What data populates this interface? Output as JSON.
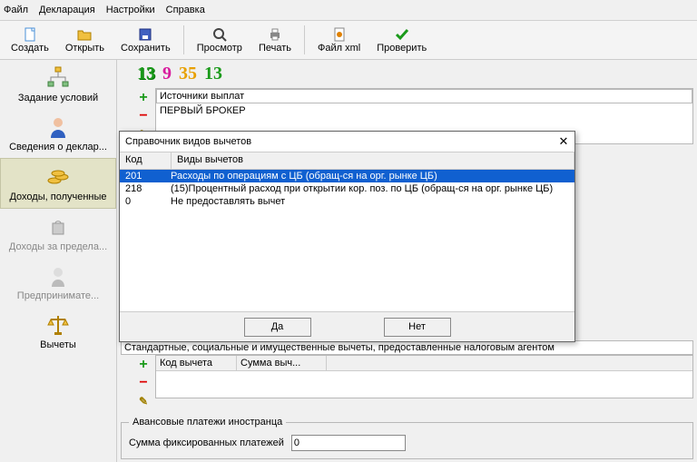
{
  "menu": {
    "file": "Файл",
    "decl": "Декларация",
    "settings": "Настройки",
    "help": "Справка"
  },
  "toolbar": {
    "create": "Создать",
    "open": "Открыть",
    "save": "Сохранить",
    "preview": "Просмотр",
    "print": "Печать",
    "xml": "Файл xml",
    "check": "Проверить"
  },
  "sidebar": {
    "cond": "Задание условий",
    "declarant": "Сведения о деклар...",
    "income_ru": "Доходы, полученные",
    "income_abroad": "Доходы за предела...",
    "entrepreneur": "Предпринимате...",
    "deductions": "Вычеты"
  },
  "tax_tabs": {
    "t13a": "13",
    "t9": "9",
    "t35": "35",
    "t13b": "13"
  },
  "sources": {
    "header": "Источники выплат",
    "row1": "ПЕРВЫЙ БРОКЕР"
  },
  "deduct_panel": {
    "header": "Стандартные, социальные и имущественные вычеты, предоставленные налоговым агентом",
    "col1": "Код вычета",
    "col2": "Сумма выч..."
  },
  "advance": {
    "legend": "Авансовые платежи иностранца",
    "label": "Сумма фиксированных платежей",
    "value": "0"
  },
  "dialog": {
    "title": "Справочник видов вычетов",
    "col_code": "Код",
    "col_type": "Виды вычетов",
    "rows": [
      {
        "code": "201",
        "desc": "Расходы по операциям с ЦБ (обращ-ся на орг. рынке ЦБ)"
      },
      {
        "code": "218",
        "desc": "(15)Процентный расход при открытии кор. поз. по ЦБ (обращ-ся на орг. рынке ЦБ)"
      },
      {
        "code": "0",
        "desc": "Не предоставлять вычет"
      }
    ],
    "yes": "Да",
    "no": "Нет"
  }
}
